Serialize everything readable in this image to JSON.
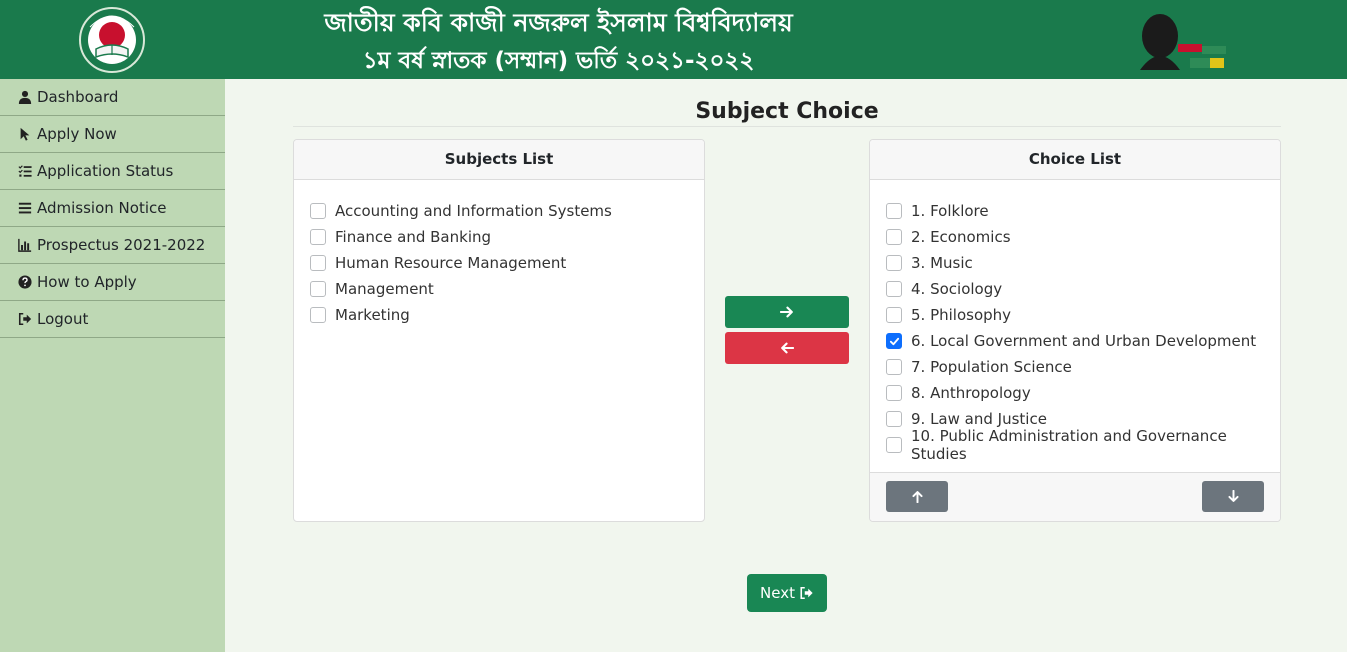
{
  "header": {
    "title_line1": "জাতীয় কবি কাজী নজরুল ইসলাম বিশ্ববিদ্যালয়",
    "title_line2": "১ম বর্ষ স্নাতক (সম্মান) ভর্তি ২০২১-২০২২",
    "logo_left_icon": "university-seal-icon",
    "logo_right_icon": "mujib-100-logo-icon",
    "bg_color": "#1a7a4c"
  },
  "sidebar": {
    "bg_color": "#bed8b4",
    "items": [
      {
        "label": "Dashboard",
        "icon": "user-icon"
      },
      {
        "label": "Apply Now",
        "icon": "pointer-icon"
      },
      {
        "label": "Application Status",
        "icon": "checklist-icon"
      },
      {
        "label": "Admission Notice",
        "icon": "bars-icon"
      },
      {
        "label": "Prospectus 2021-2022",
        "icon": "bar-chart-icon"
      },
      {
        "label": "How to Apply",
        "icon": "question-circle-icon"
      },
      {
        "label": "Logout",
        "icon": "sign-out-icon"
      }
    ]
  },
  "main": {
    "title": "Subject Choice",
    "subjects_list": {
      "header": "Subjects List",
      "items": [
        {
          "label": "Accounting and Information Systems",
          "checked": false
        },
        {
          "label": "Finance and Banking",
          "checked": false
        },
        {
          "label": "Human Resource Management",
          "checked": false
        },
        {
          "label": "Management",
          "checked": false
        },
        {
          "label": "Marketing",
          "checked": false
        }
      ]
    },
    "choice_list": {
      "header": "Choice List",
      "items": [
        {
          "label": "1. Folklore",
          "checked": false
        },
        {
          "label": "2. Economics",
          "checked": false
        },
        {
          "label": "3. Music",
          "checked": false
        },
        {
          "label": "4. Sociology",
          "checked": false
        },
        {
          "label": "5. Philosophy",
          "checked": false
        },
        {
          "label": "6. Local Government and Urban Development",
          "checked": true
        },
        {
          "label": "7. Population Science",
          "checked": false
        },
        {
          "label": "8. Anthropology",
          "checked": false
        },
        {
          "label": "9. Law and Justice",
          "checked": false
        },
        {
          "label": "10. Public Administration and Governance Studies",
          "checked": false
        }
      ]
    },
    "transfer": {
      "add_icon": "arrow-right-icon",
      "remove_icon": "arrow-left-icon",
      "add_color": "#198754",
      "remove_color": "#dc3545"
    },
    "order": {
      "up_icon": "arrow-up-icon",
      "down_icon": "arrow-down-icon"
    },
    "next": {
      "label": "Next",
      "icon": "sign-out-icon"
    }
  }
}
